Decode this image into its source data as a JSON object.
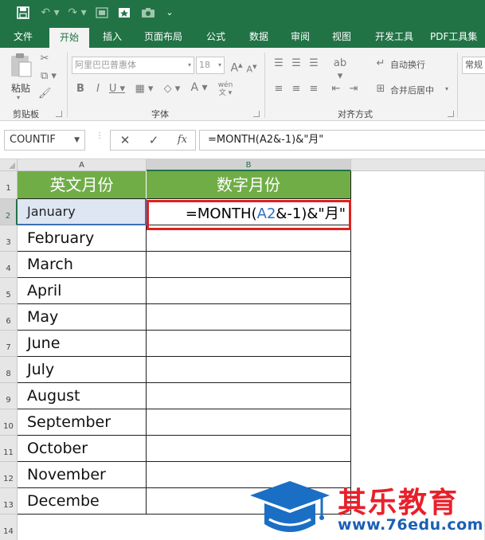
{
  "qat": {
    "save_icon": "save-icon",
    "undo_icon": "undo-icon",
    "redo_icon": "redo-icon",
    "more": "⌄"
  },
  "tabs": [
    {
      "label": "文件"
    },
    {
      "label": "开始"
    },
    {
      "label": "插入"
    },
    {
      "label": "页面布局"
    },
    {
      "label": "公式"
    },
    {
      "label": "数据"
    },
    {
      "label": "审阅"
    },
    {
      "label": "视图"
    },
    {
      "label": "开发工具"
    },
    {
      "label": "PDF工具集"
    }
  ],
  "ribbon": {
    "clipboard": {
      "paste_label": "粘贴",
      "group_label": "剪贴板"
    },
    "font": {
      "font_name": "阿里巴巴普惠体",
      "font_size": "18",
      "group_label": "字体"
    },
    "alignment": {
      "wrap_label": "自动换行",
      "merge_label": "合并后居中",
      "group_label": "对齐方式"
    },
    "number": {
      "format_label": "常规"
    }
  },
  "formula_bar": {
    "name_box": "COUNTIF",
    "cancel": "✕",
    "enter": "✓",
    "fx": "fx",
    "formula": "=MONTH(A2&-1)&\"月\""
  },
  "grid": {
    "col_headers": [
      "A",
      "B"
    ],
    "row_headers": [
      "1",
      "2",
      "3",
      "4",
      "5",
      "6",
      "7",
      "8",
      "9",
      "10",
      "11",
      "12",
      "13",
      "14"
    ],
    "header_a": "英文月份",
    "header_b": "数字月份",
    "months": [
      "January",
      "February",
      "March",
      "April",
      "May",
      "June",
      "July",
      "August",
      "September",
      "October",
      "November",
      "Decembe"
    ],
    "edit_formula": {
      "pre": "=MONTH(",
      "ref": "A2",
      "post": "&-1)&\"月\""
    }
  },
  "logo": {
    "name": "其乐教育",
    "url": "www.76edu.com"
  },
  "colors": {
    "excel_green": "#217346",
    "header_fill": "#70ad47",
    "edit_border": "#e02020",
    "ref_blue": "#2f6fbf",
    "logo_red": "#e8202a",
    "logo_blue": "#1a5fb4"
  }
}
